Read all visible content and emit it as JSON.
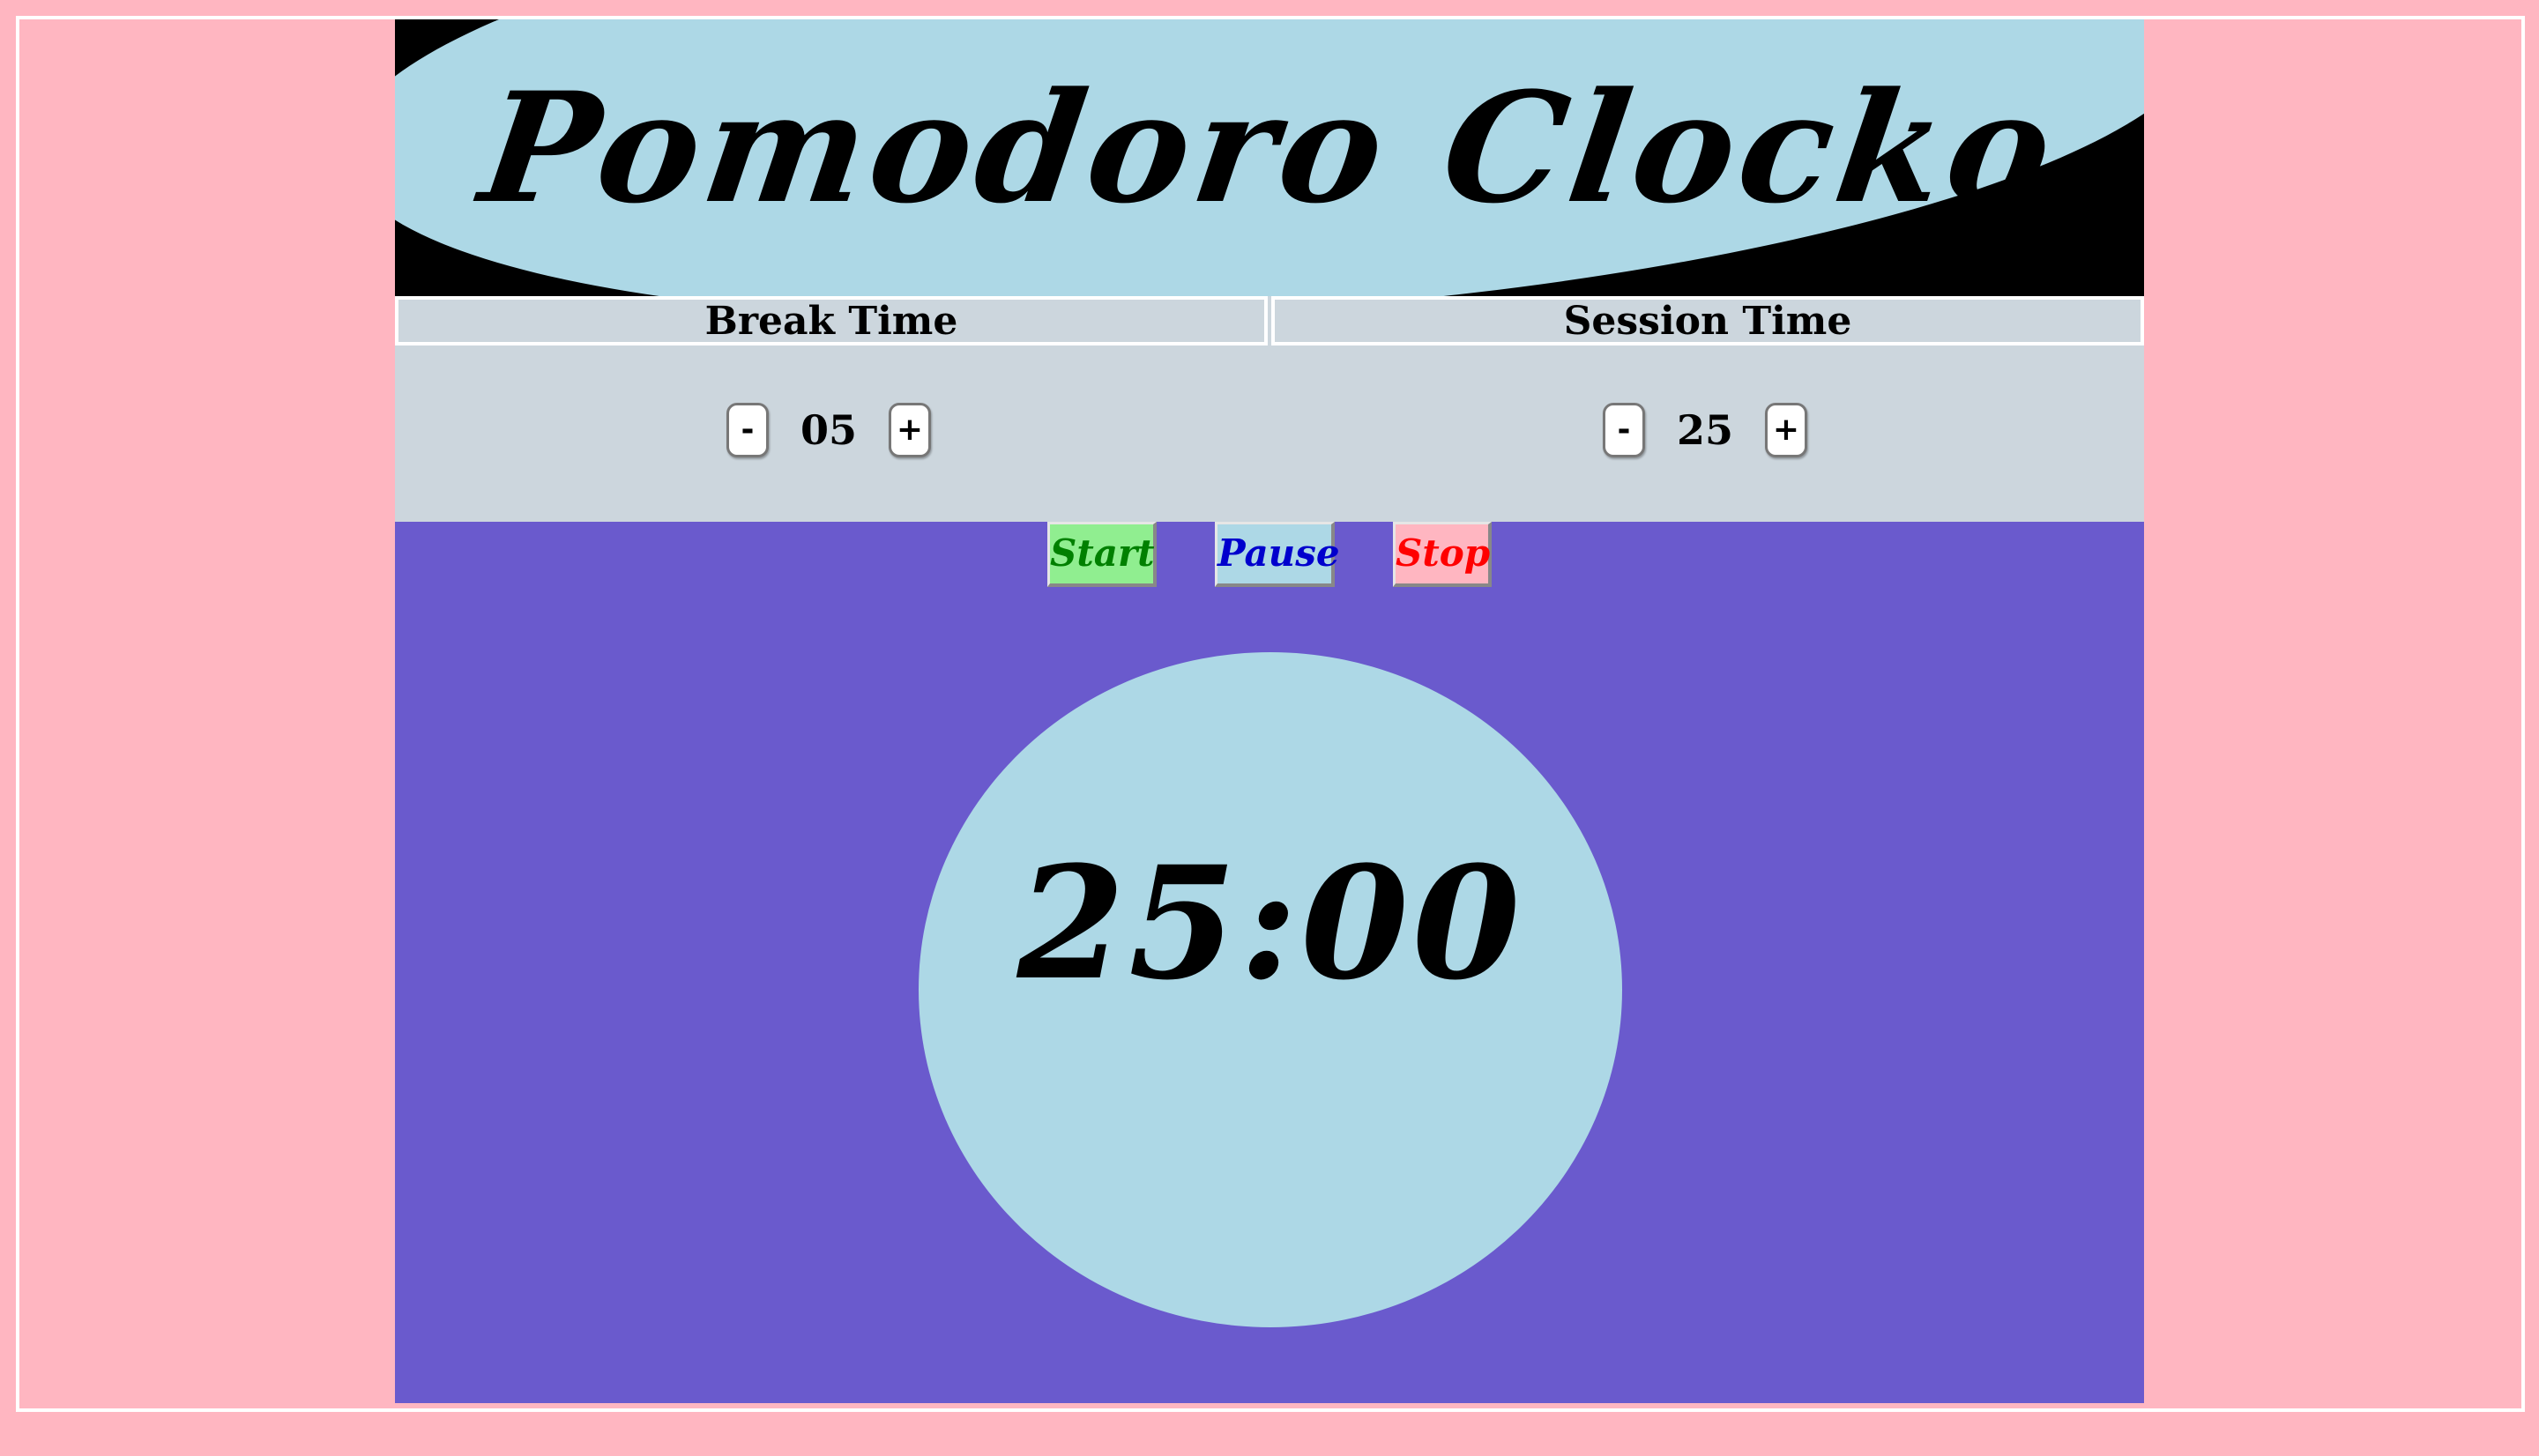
{
  "header": {
    "title": "Pomodoro Clocko"
  },
  "settings": {
    "break": {
      "label": "Break Time",
      "value": "05",
      "decrement_label": "-",
      "increment_label": "+"
    },
    "session": {
      "label": "Session Time",
      "value": "25",
      "decrement_label": "-",
      "increment_label": "+"
    }
  },
  "controls": {
    "start_label": "Start",
    "pause_label": "Pause",
    "stop_label": "Stop"
  },
  "clock": {
    "time": "25:00"
  },
  "colors": {
    "page_bg": "#ffb6c1",
    "app_bg": "#6a5acd",
    "header_bg": "#add8e6",
    "settings_bg": "#ccd6dd",
    "start_bg": "#90ee90",
    "start_text": "#008000",
    "pause_bg": "#add8e6",
    "pause_text": "#0000cd",
    "stop_bg": "#ffb6c1",
    "stop_text": "#ff0000"
  }
}
